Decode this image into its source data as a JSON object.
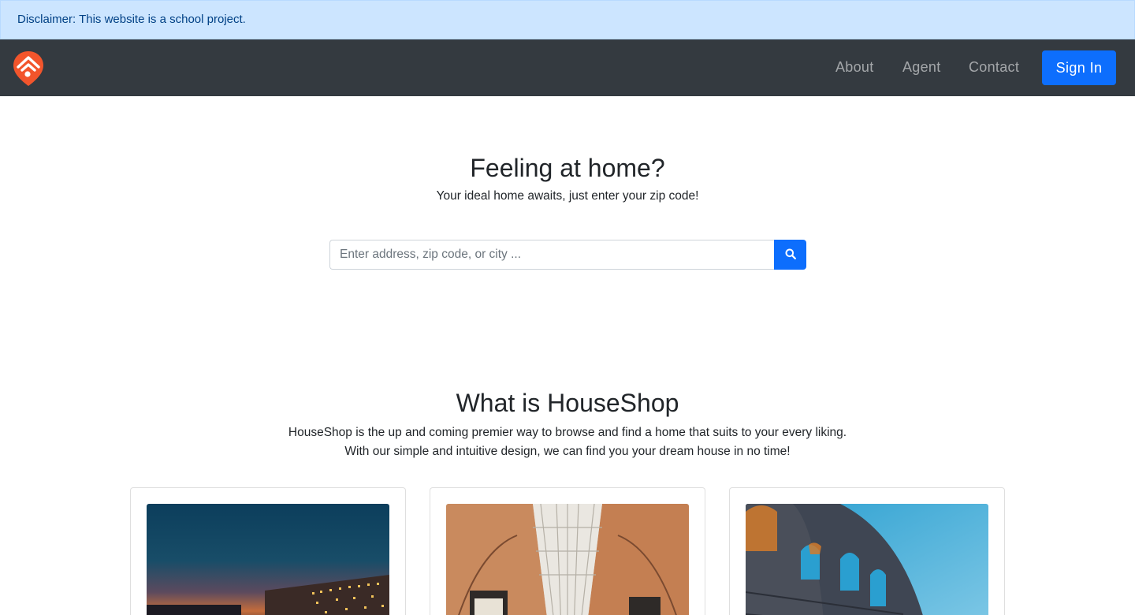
{
  "disclaimer": {
    "text": "Disclaimer: This website is a school project."
  },
  "navbar": {
    "links": [
      {
        "label": "About"
      },
      {
        "label": "Agent"
      },
      {
        "label": "Contact"
      }
    ],
    "signin_label": "Sign In",
    "logo_icon": "house-location-pin-icon",
    "colors": {
      "background": "#343a40",
      "logo": "#f2552c",
      "primary": "#0d6efd"
    }
  },
  "hero": {
    "title": "Feeling at home?",
    "subtitle": "Your ideal home awaits, just enter your zip code!",
    "search": {
      "value": "",
      "placeholder": "Enter address, zip code, or city ...",
      "button_icon": "search-icon"
    }
  },
  "about": {
    "title": "What is HouseShop",
    "line1": "HouseShop is the up and coming premier way to browse and find a home that suits to your every liking.",
    "line2": "With our simple and intuitive design, we can find you your dream house in no time!"
  },
  "cards": [
    {
      "image": "building-at-dusk-photo"
    },
    {
      "image": "shopping-arcade-glass-roof-photo"
    },
    {
      "image": "colosseum-arches-photo"
    }
  ]
}
